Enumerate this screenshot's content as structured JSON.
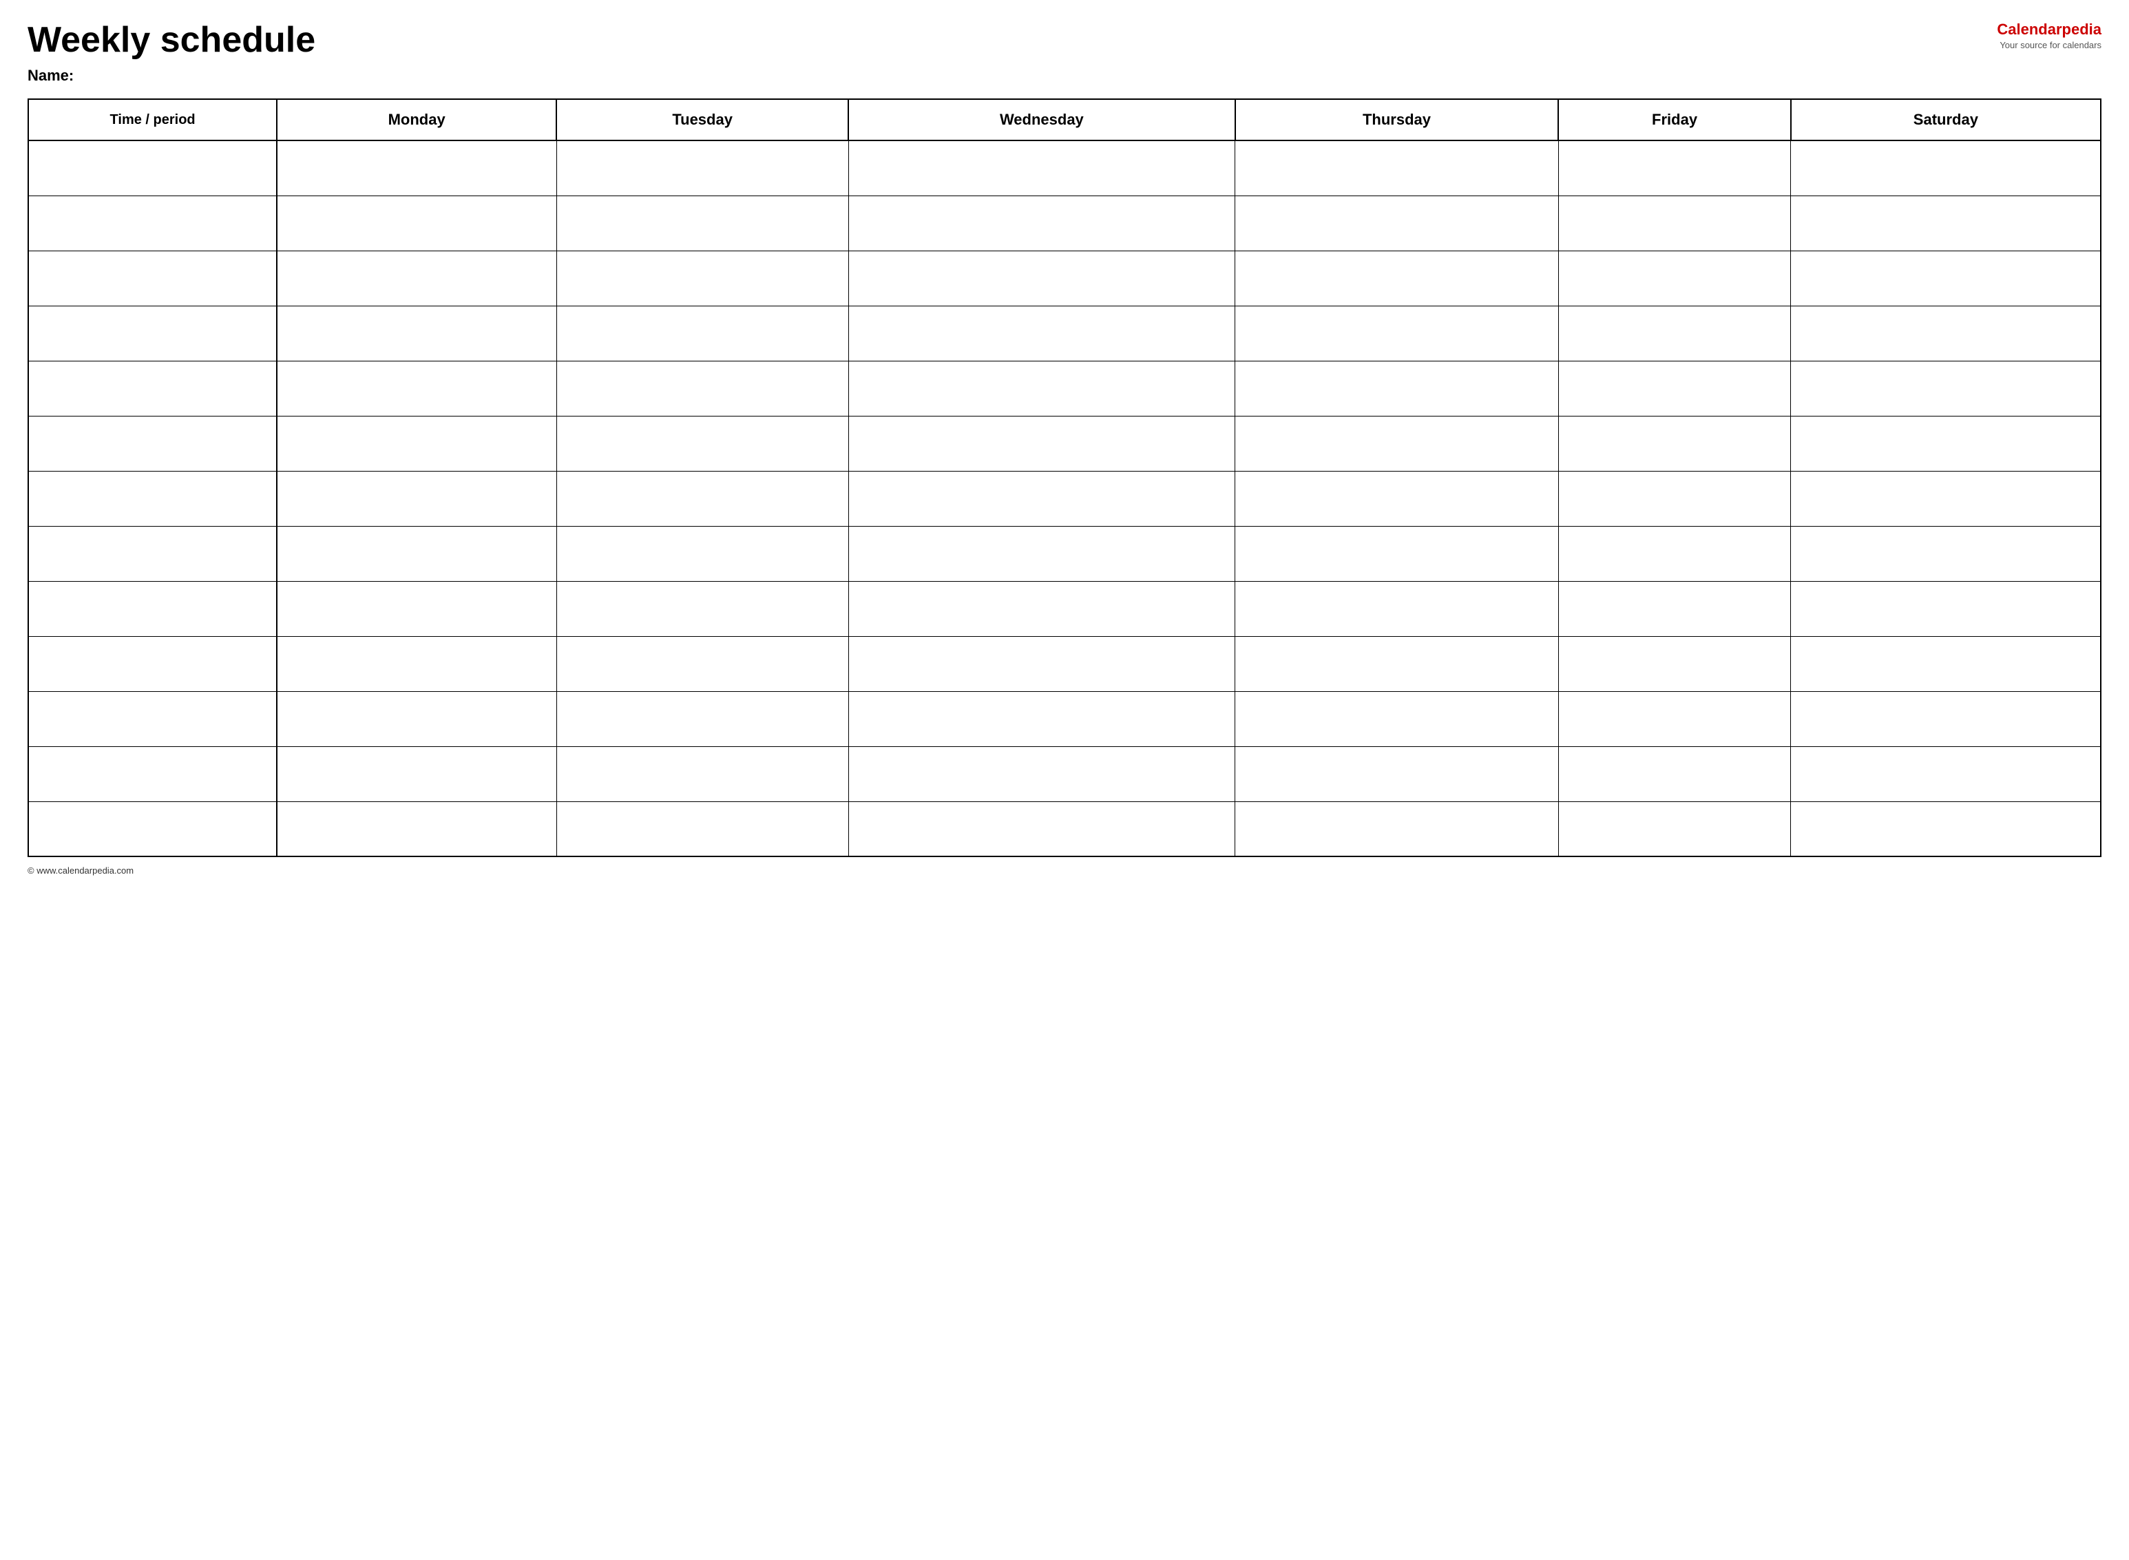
{
  "header": {
    "title": "Weekly schedule",
    "logo": {
      "text_plain": "Calendar",
      "text_accent": "pedia",
      "subtitle": "Your source for calendars"
    },
    "name_label": "Name:"
  },
  "table": {
    "columns": [
      "Time / period",
      "Monday",
      "Tuesday",
      "Wednesday",
      "Thursday",
      "Friday",
      "Saturday"
    ],
    "row_count": 13
  },
  "footer": {
    "text": "© www.calendarpedia.com"
  }
}
